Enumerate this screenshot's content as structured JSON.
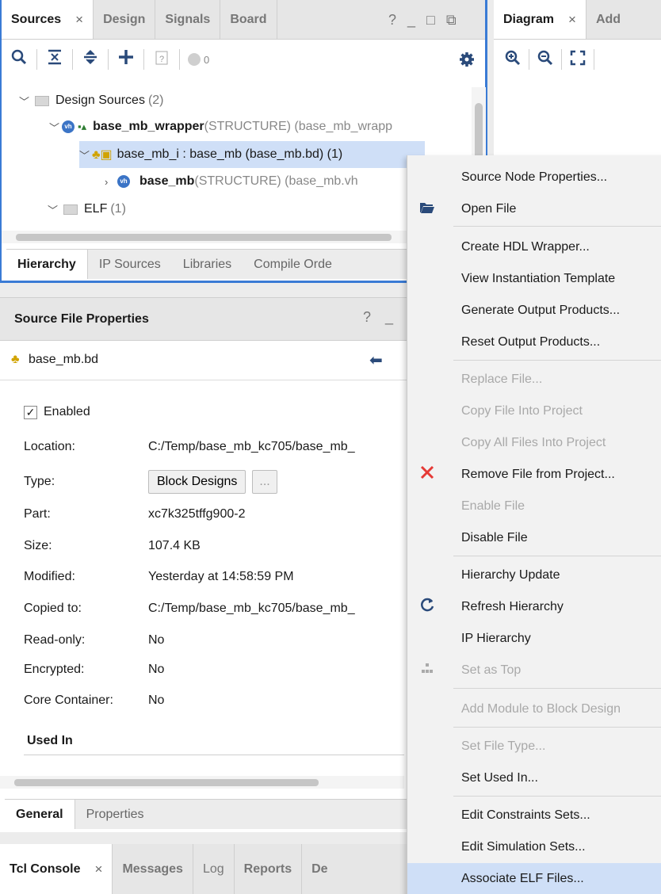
{
  "sources": {
    "tabs": [
      {
        "label": "Sources",
        "close": "×"
      },
      {
        "label": "Design"
      },
      {
        "label": "Signals"
      },
      {
        "label": "Board"
      }
    ],
    "controls": {
      "help": "?",
      "minimize": "_",
      "maximize": "□",
      "float": "⧉"
    },
    "toolbar": {
      "counter": "0"
    },
    "tree": {
      "design_sources": {
        "label": "Design Sources",
        "count": "(2)"
      },
      "wrapper": {
        "name": "base_mb_wrapper",
        "detail": "(STRUCTURE) (base_mb_wrapp",
        "badge": "vh"
      },
      "bd_instance": {
        "label": "base_mb_i : base_mb (base_mb.bd) (1)"
      },
      "base_mb": {
        "name": "base_mb",
        "detail": "(STRUCTURE) (base_mb.vh",
        "badge": "vh"
      },
      "elf": {
        "label": "ELF",
        "count": "(1)"
      }
    },
    "bottom_tabs": [
      "Hierarchy",
      "IP Sources",
      "Libraries",
      "Compile Orde"
    ]
  },
  "diagram": {
    "tabs": [
      {
        "label": "Diagram",
        "close": "×"
      },
      {
        "label": "Add"
      }
    ]
  },
  "properties": {
    "title": "Source File Properties",
    "help": "?",
    "minimize": "_",
    "file": "base_mb.bd",
    "enabled_label": "Enabled",
    "enabled_check": "✓",
    "rows": [
      {
        "label": "Location:",
        "value": "C:/Temp/base_mb_kc705/base_mb_"
      },
      {
        "label": "Type:",
        "value": "Block Designs",
        "extra": "..."
      },
      {
        "label": "Part:",
        "value": "xc7k325tffg900-2"
      },
      {
        "label": "Size:",
        "value": "107.4 KB"
      },
      {
        "label": "Modified:",
        "value": "Yesterday at 14:58:59 PM"
      },
      {
        "label": "Copied to:",
        "value": "C:/Temp/base_mb_kc705/base_mb_"
      },
      {
        "label": "Read-only:",
        "value": "No"
      },
      {
        "label": "Encrypted:",
        "value": "No"
      },
      {
        "label": "Core Container:",
        "value": "No"
      }
    ],
    "used_in": "Used In",
    "bottom_tabs": [
      "General",
      "Properties"
    ]
  },
  "tcl": {
    "tabs": [
      {
        "label": "Tcl Console",
        "close": "×"
      },
      {
        "label": "Messages"
      },
      {
        "label": "Log"
      },
      {
        "label": "Reports"
      },
      {
        "label": "De"
      }
    ]
  },
  "context_menu": {
    "items": [
      {
        "label": "Source Node Properties...",
        "icon": ""
      },
      {
        "label": "Open File",
        "icon": "folder-open-icon"
      },
      {
        "label": "Create HDL Wrapper...",
        "icon": ""
      },
      {
        "label": "View Instantiation Template",
        "icon": ""
      },
      {
        "label": "Generate Output Products...",
        "icon": ""
      },
      {
        "label": "Reset Output Products...",
        "icon": ""
      },
      {
        "label": "Replace File...",
        "icon": ""
      },
      {
        "label": "Copy File Into Project",
        "icon": ""
      },
      {
        "label": "Copy All Files Into Project",
        "icon": ""
      },
      {
        "label": "Remove File from Project...",
        "icon": "red-x-icon"
      },
      {
        "label": "Enable File",
        "icon": ""
      },
      {
        "label": "Disable File",
        "icon": ""
      },
      {
        "label": "Hierarchy Update",
        "icon": ""
      },
      {
        "label": "Refresh Hierarchy",
        "icon": "refresh-icon"
      },
      {
        "label": "IP Hierarchy",
        "icon": ""
      },
      {
        "label": "Set as Top",
        "icon": "set-top-icon"
      },
      {
        "label": "Add Module to Block Design",
        "icon": ""
      },
      {
        "label": "Set File Type...",
        "icon": ""
      },
      {
        "label": "Set Used In...",
        "icon": ""
      },
      {
        "label": "Edit Constraints Sets...",
        "icon": ""
      },
      {
        "label": "Edit Simulation Sets...",
        "icon": ""
      },
      {
        "label": "Associate ELF Files...",
        "icon": ""
      }
    ]
  },
  "colors": {
    "accent": "#3a7bd5",
    "selection": "#cfdff7",
    "danger": "#e53935"
  }
}
